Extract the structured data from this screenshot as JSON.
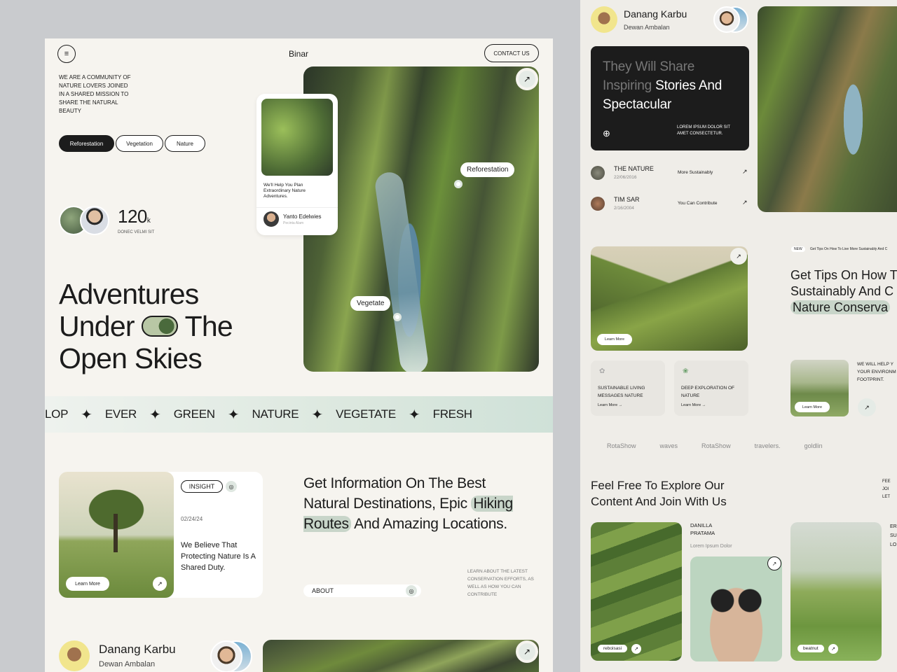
{
  "left": {
    "brand": "Binar",
    "contact_label": "CONTACT US",
    "intro": "WE ARE A COMMUNITY OF NATURE LOVERS JOINED IN A SHARED MISSION TO SHARE THE NATURAL BEAUTY",
    "tags": [
      "Reforestation",
      "Vegetation",
      "Nature"
    ],
    "stat_value": "120",
    "stat_unit": "k",
    "stat_caption": "DONEC VELMI SIT",
    "hero_line1": "Adventures",
    "hero_line2a": "Under",
    "hero_line2b": "The",
    "hero_line3": "Open Skies",
    "mini_card_text": "We'll Help You Plan Extraordinary Nature Adventures.",
    "mini_card_author": "Yanto Edelwies",
    "mini_card_role": "Pecinta Alam",
    "hotspot1": "Reforestation",
    "hotspot2": "Vegetate",
    "marquee": [
      "LOP",
      "EVER",
      "GREEN",
      "NATURE",
      "VEGETATE",
      "FRESH"
    ],
    "insight_badge": "INSIGHT",
    "insight_date": "02/24/24",
    "insight_text": "We Believe That Protecting Nature Is A Shared Duty.",
    "learn_more": "Learn More",
    "info_pre": "Get Information On The Best Natural Destinations, Epic",
    "info_hl": "Hiking Routes",
    "info_post": "And Amazing Locations.",
    "about_label": "ABOUT",
    "info_note": "LEARN ABOUT THE LATEST CONSERVATION EFFORTS, AS WELL AS HOW YOU CAN CONTRIBUTE",
    "profile_name": "Danang Karbu",
    "profile_role": "Dewan Ambalan"
  },
  "right": {
    "profile_name": "Danang Karbu",
    "profile_role": "Dewan Ambalan",
    "dark_card_dim": "They Will Share Inspiring",
    "dark_card_bright": "Stories And Spectacular",
    "dark_card_note": "LOREM IPSUM DOLOR SIT AMET CONSECTETUR.",
    "list": [
      {
        "name": "THE NATURE",
        "date": "22/06/2016",
        "tag": "More Sustainably"
      },
      {
        "name": "TIM SAR",
        "date": "2/16/2004",
        "tag": "You Can Contribute"
      }
    ],
    "new_badge": "NEW",
    "new_note": "Get Tips On How To Live More Sustainably And C",
    "tips_line1": "Get Tips On How T",
    "tips_line2": "Sustainably And C",
    "tips_line3": "Nature Conserva",
    "learn_more": "Learn More",
    "feature1": "SUSTAINABLE LIVING MESSAGES NATURE",
    "feature2": "DEEP EXPLORATION OF NATURE",
    "help_note": "WE WILL HELP Y YOUR ENVIRONM FOOTPRINT.",
    "logos": [
      "RotaShow",
      "waves",
      "RotaShow",
      "travelers.",
      "goldlin"
    ],
    "explore_line1": "Feel Free To Explore Our",
    "explore_line2": "Content And Join With Us",
    "side_note": "FEE JOI LET",
    "author_name": "DANILLA PRATAMA",
    "author_sub": "Lorem Ipsum Dolor",
    "chip1": "reboisasi",
    "chip2": "beatnut",
    "far_note": "ER SU Lo"
  }
}
